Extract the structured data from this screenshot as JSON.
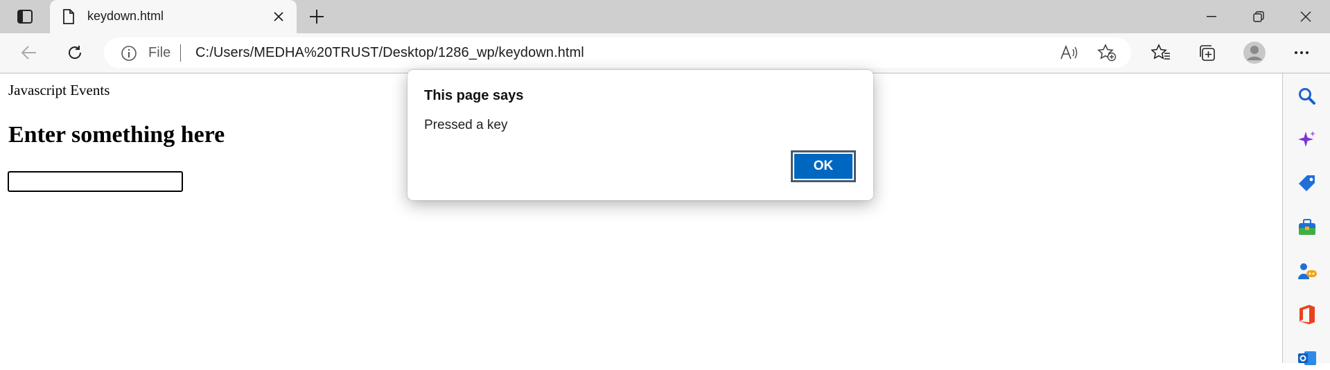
{
  "tab": {
    "title": "keydown.html"
  },
  "address_bar": {
    "scheme_label": "File",
    "url": "C:/Users/MEDHA%20TRUST/Desktop/1286_wp/keydown.html"
  },
  "page": {
    "text": "Javascript Events",
    "heading": "Enter something here",
    "input_value": ""
  },
  "dialog": {
    "title": "This page says",
    "message": "Pressed a key",
    "ok_label": "OK"
  },
  "colors": {
    "accent": "#0067c0",
    "tabbar": "#cfcfcf",
    "toolbar": "#f7f7f7"
  },
  "icons": {
    "toolbar": [
      "back-icon",
      "refresh-icon",
      "info-icon",
      "read-aloud-icon",
      "add-favorite-icon",
      "favorites-icon",
      "collections-icon",
      "profile-icon",
      "more-icon"
    ],
    "sidebar": [
      "search-icon",
      "copilot-icon",
      "shopping-icon",
      "tools-icon",
      "games-icon",
      "office-icon",
      "outlook-icon"
    ]
  }
}
